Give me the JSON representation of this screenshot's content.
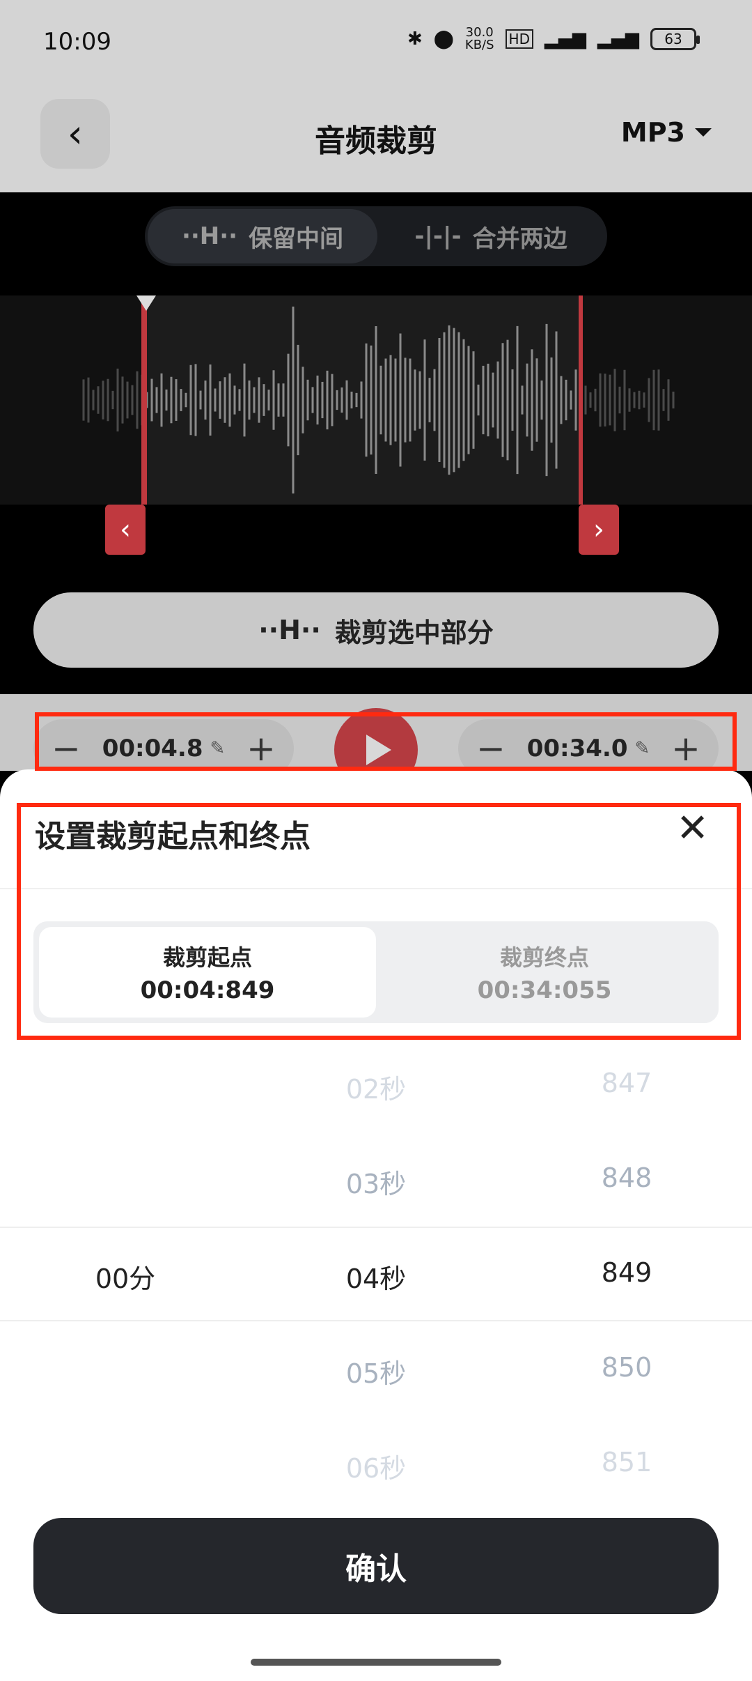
{
  "status": {
    "time": "10:09",
    "net_speed": "30.0\nKB/S",
    "battery": "63"
  },
  "appbar": {
    "title": "音频裁剪",
    "format": "MP3"
  },
  "modes": [
    "保留中间",
    "合并两边"
  ],
  "crop_button": "裁剪选中部分",
  "controls": {
    "start_value": "00:04.8",
    "end_value": "00:34.0"
  },
  "sheet": {
    "title": "设置裁剪起点和终点",
    "start_label": "裁剪起点",
    "start_value": "00:04:849",
    "end_label": "裁剪终点",
    "end_value": "00:34:055"
  },
  "picker": {
    "minutes": "00分",
    "seconds": [
      "02秒",
      "03秒",
      "04秒",
      "05秒",
      "06秒"
    ],
    "millis": [
      "847",
      "848",
      "849",
      "850",
      "851"
    ]
  },
  "confirm": "确认",
  "colors": {
    "accent_red": "#c0393f",
    "highlight": "#ff2a10",
    "confirm_bg": "#25272c"
  }
}
